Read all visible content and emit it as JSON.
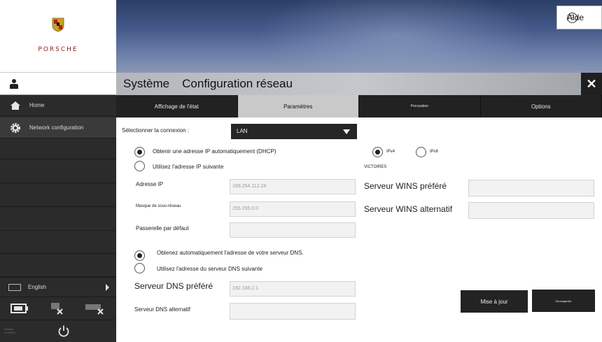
{
  "brand": {
    "wordmark": "PORSCHE"
  },
  "header": {
    "help_label": "Aide"
  },
  "titlebar": {
    "section": "Système",
    "page": "Configuration réseau",
    "close_glyph": "✕"
  },
  "tabs": [
    {
      "label": "Affichage de l'état",
      "selected": false
    },
    {
      "label": "Paramètres",
      "selected": true
    },
    {
      "label": "Procuration",
      "selected": false
    },
    {
      "label": "Options",
      "selected": false
    }
  ],
  "sidebar": {
    "items": [
      {
        "label": "Home",
        "icon": "home-icon"
      },
      {
        "label": "Network configuration",
        "icon": "gear-icon"
      }
    ],
    "language": "English",
    "version_text": "Version\n01.00.00"
  },
  "form": {
    "connection_label": "Sélectionner la connexion :",
    "connection_value": "LAN",
    "ip_auto_label": "Obtenir une adresse IP automatiquement (DHCP)",
    "ip_manual_label": "Utilisez l'adresse IP suivante",
    "ip_auto_selected": true,
    "ipv4_label": "IPv4",
    "ipv6_label": "IPv6",
    "ipv4_selected": true,
    "wins_section": "VICTOIRES",
    "ip_address_label": "Adresse IP",
    "ip_address_value": "169.254.112.24",
    "subnet_label": "Masque de sous-réseau",
    "subnet_value": "255.255.0.0",
    "gateway_label": "Passerelle par défaut",
    "gateway_value": "",
    "wins_preferred_label": "Serveur WINS préféré",
    "wins_preferred_value": "",
    "wins_alternate_label": "Serveur WINS alternatif",
    "wins_alternate_value": "",
    "dns_auto_label": "Obtenez automatiquement l'adresse de votre serveur DNS.",
    "dns_manual_label": "Utilisez l'adresse du serveur DNS suivante",
    "dns_auto_selected": true,
    "dns_preferred_label": "Serveur DNS préféré",
    "dns_preferred_value": "192.168.2.1",
    "dns_alternate_label": "Serveur DNS alternatif",
    "dns_alternate_value": ""
  },
  "actions": {
    "update_label": "Mise à jour",
    "save_label": "Sauvegarder"
  },
  "colors": {
    "sidebar_bg": "#2b2b2b",
    "tab_selected_bg": "#c9c9c9",
    "banner_top": "#2c3f66",
    "brand_red": "#8a1d1d"
  }
}
